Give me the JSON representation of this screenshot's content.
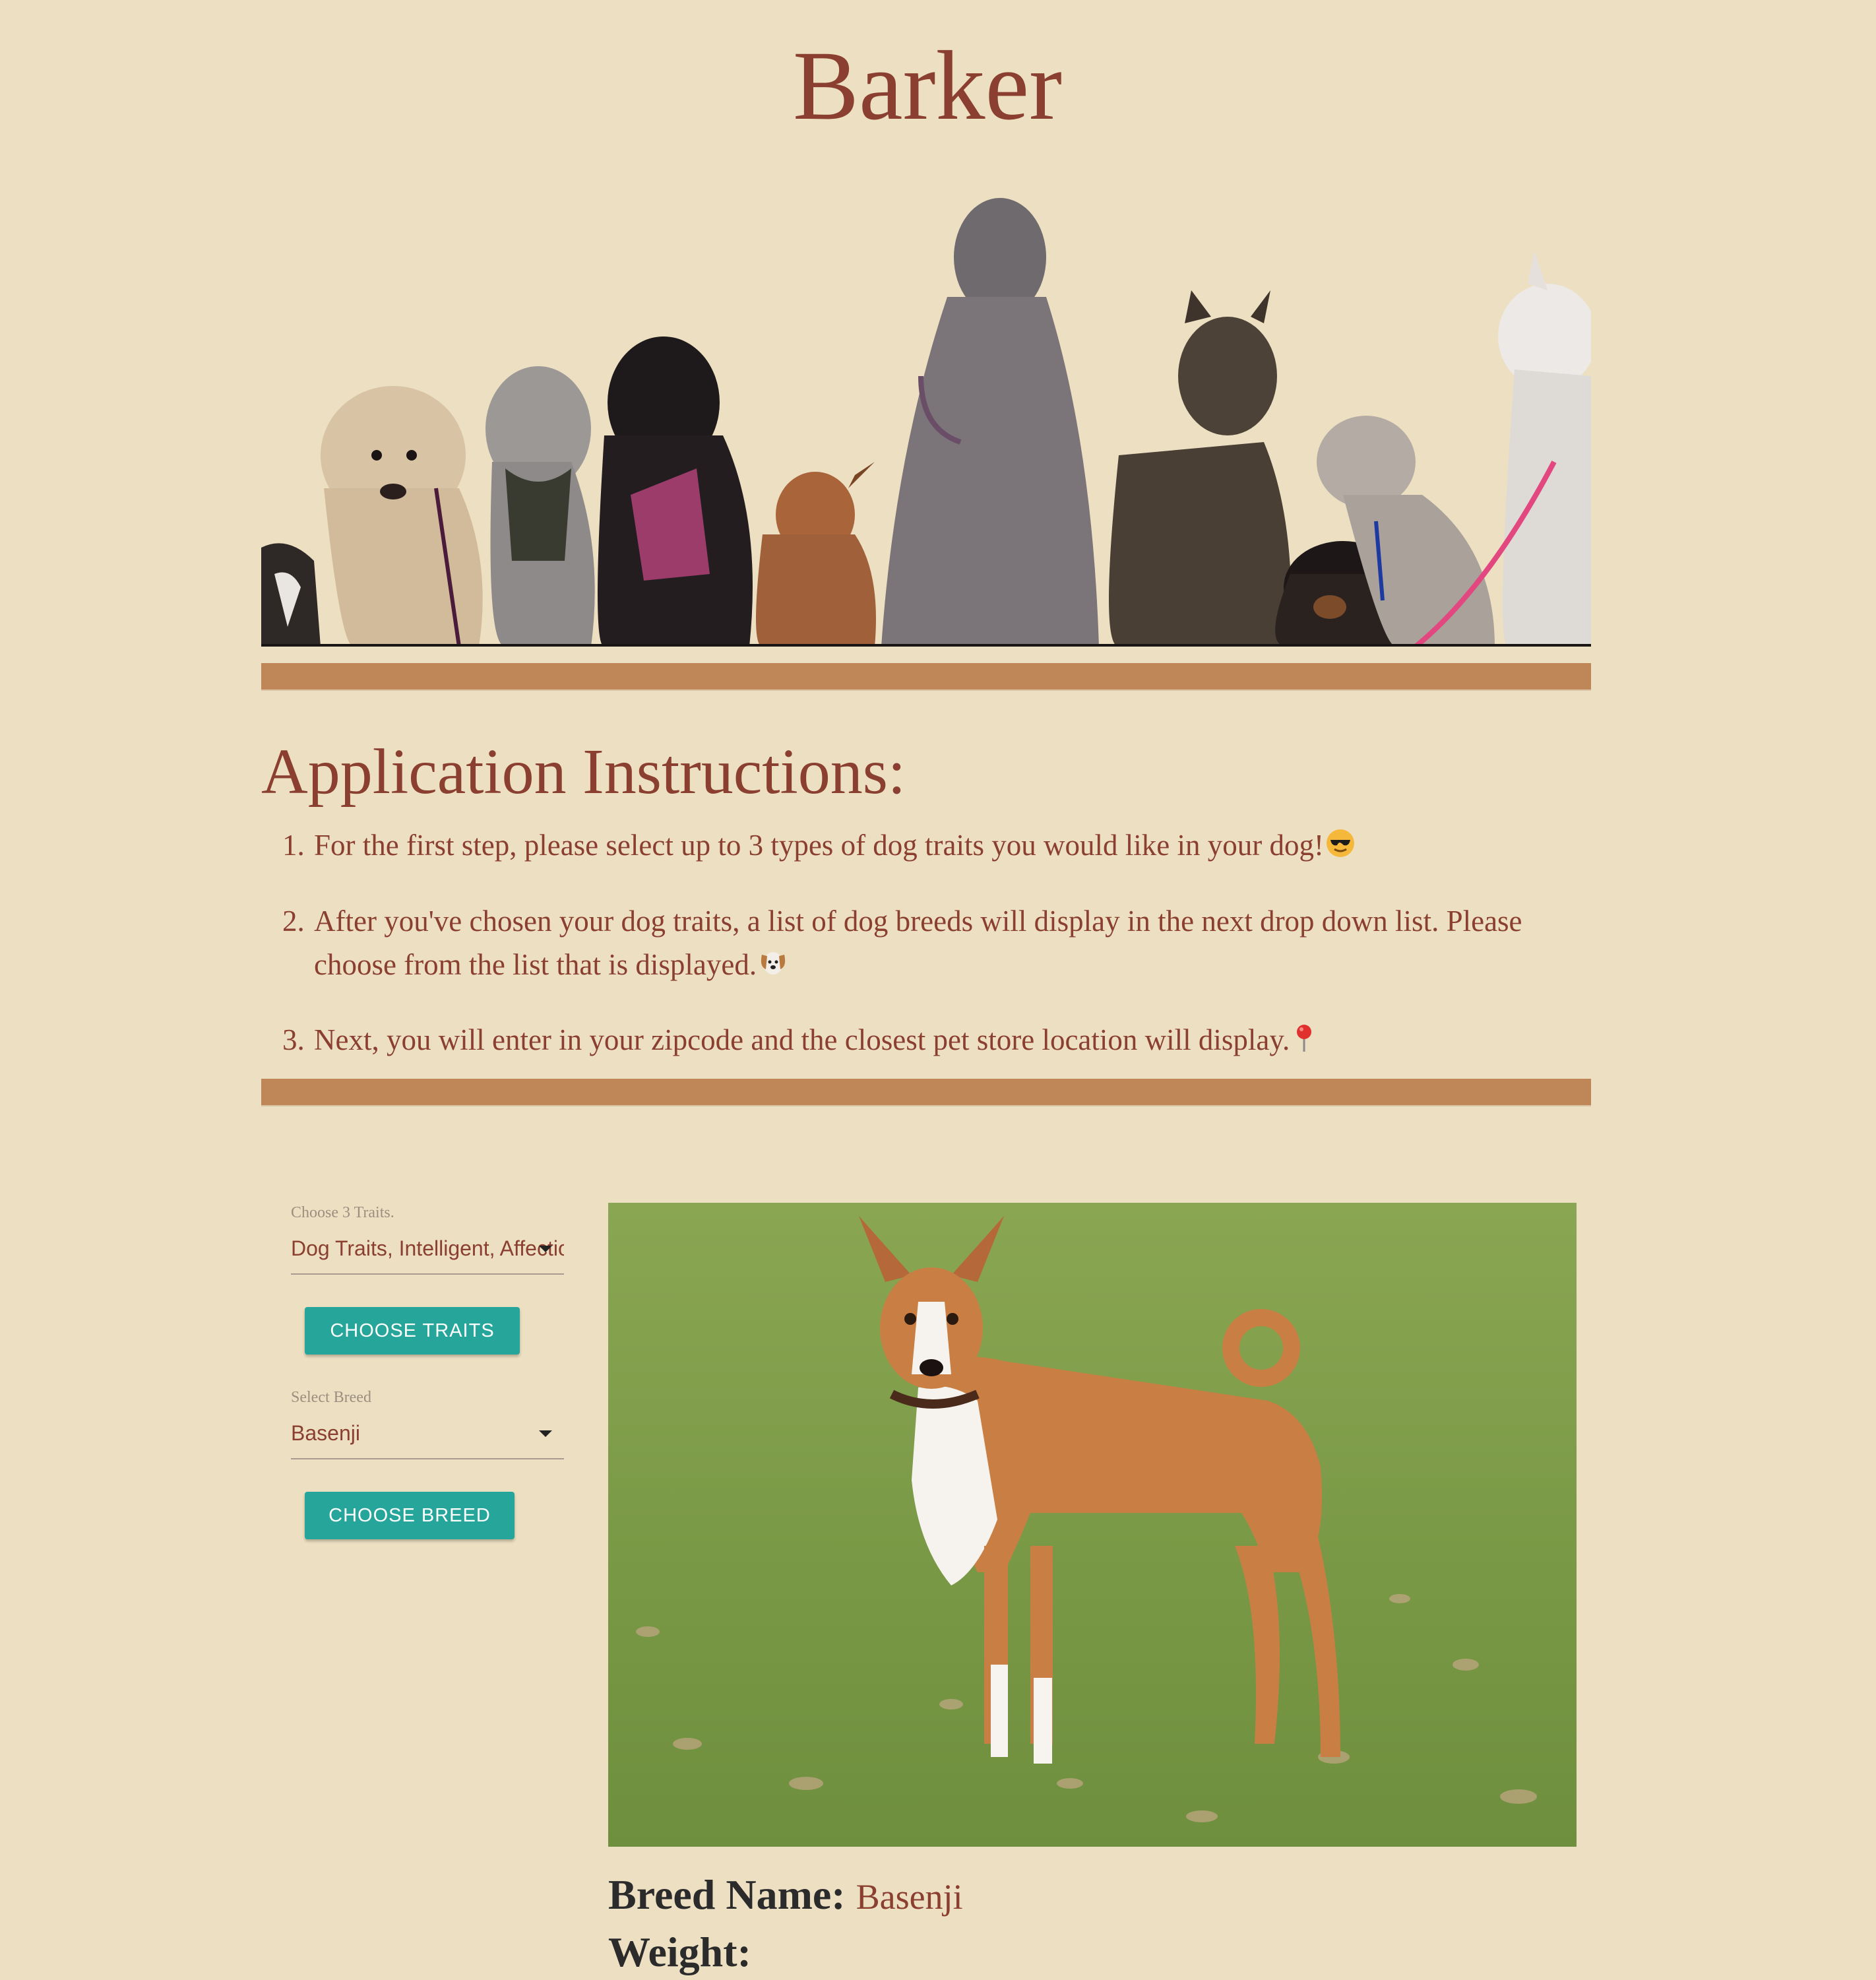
{
  "app": {
    "title": "Barker"
  },
  "hero": {
    "image": "dog-group-banner"
  },
  "instructions": {
    "heading": "Application Instructions:",
    "steps": [
      {
        "num": "1.",
        "text": "For the first step, please select up to 3 types of dog traits you would like in your dog!",
        "emoji": "sunglasses-emoji"
      },
      {
        "num": "2.",
        "text": "After you've chosen your dog traits, a list of dog breeds will display in the next drop down list. Please choose from the list that is displayed.",
        "emoji": "dog-face-emoji"
      },
      {
        "num": "3.",
        "text": "Next, you will enter in your zipcode and the closest pet store location will display.",
        "emoji": "round-pushpin-emoji"
      }
    ]
  },
  "form": {
    "traits_label": "Choose 3 Traits.",
    "traits_value": "Dog Traits, Intelligent, Affectionate",
    "choose_traits_button": "CHOOSE TRAITS",
    "breed_label": "Select Breed",
    "breed_value": "Basenji",
    "choose_breed_button": "CHOOSE BREED"
  },
  "result": {
    "photo": "basenji-photo",
    "breed_name_label": "Breed Name:",
    "breed_name_value": "Basenji",
    "weight_label": "Weight:"
  },
  "colors": {
    "background": "#ede0c2",
    "text": "#8a3f30",
    "divider": "#bf8658",
    "button": "#26a69a"
  }
}
